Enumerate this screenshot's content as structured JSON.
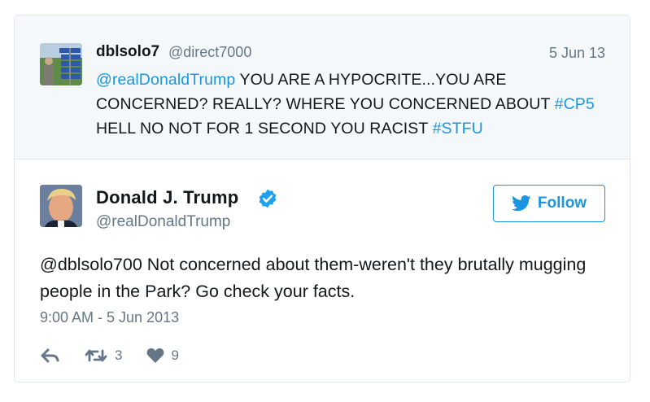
{
  "quoted_tweet": {
    "name": "dblsolo7",
    "handle": "@direct7000",
    "date": "5 Jun 13",
    "text_parts": {
      "mention": "@realDonaldTrump",
      "t1": " YOU ARE A HYPOCRITE...YOU ARE CONCERNED? REALLY? WHERE YOU CONCERNED ABOUT ",
      "hashtag1": "#CP5",
      "t2": " HELL NO NOT FOR 1 SECOND YOU RACIST ",
      "hashtag2": "#STFU"
    }
  },
  "tweet": {
    "name": "Donald J. Trump",
    "handle": "@realDonaldTrump",
    "text": "@dblsolo700 Not concerned about them-weren't they brutally mugging people in the Park? Go check your facts.",
    "timestamp": "9:00 AM - 5 Jun 2013",
    "retweets": "3",
    "likes": "9"
  },
  "follow_button": {
    "label": "Follow"
  },
  "colors": {
    "link": "#1b95e0",
    "muted": "#657786",
    "quoted_bg": "#f5f8fa"
  },
  "icons": [
    "twitter-bird-icon",
    "verified-badge-icon",
    "reply-icon",
    "retweet-icon",
    "heart-icon"
  ]
}
